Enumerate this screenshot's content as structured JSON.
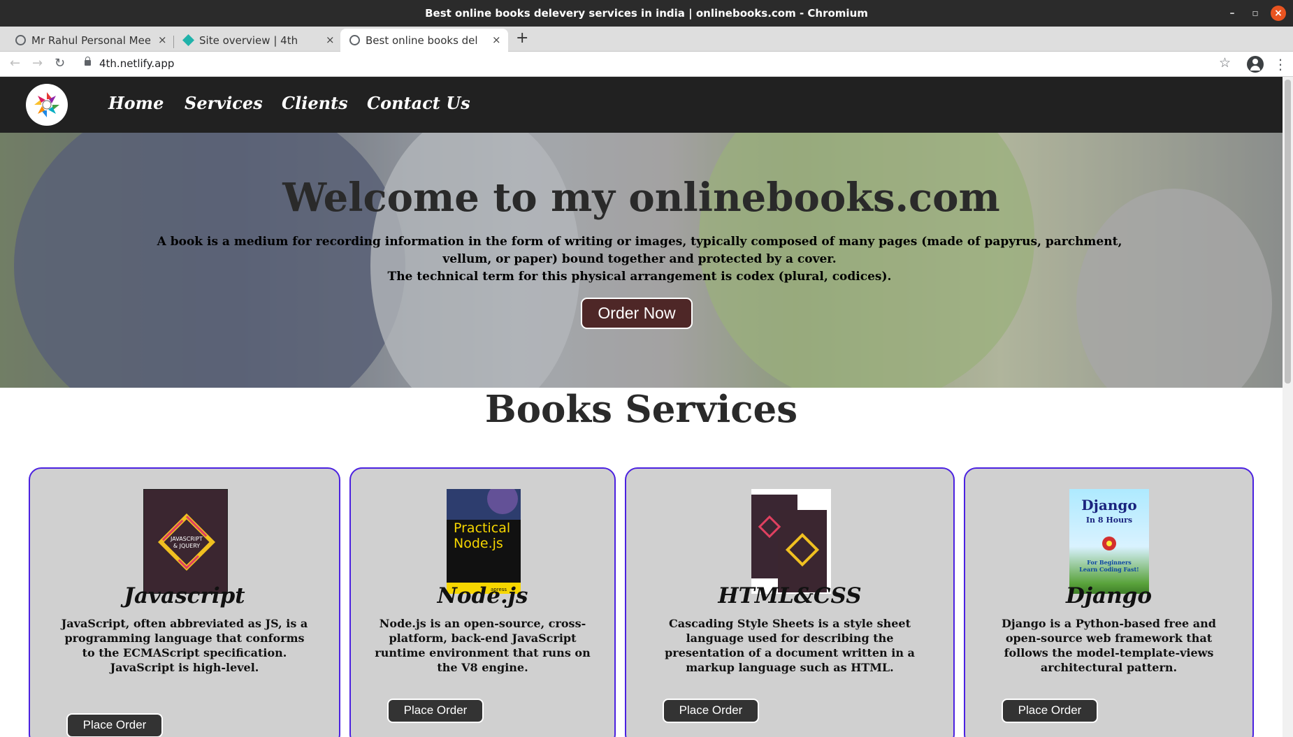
{
  "browser": {
    "window_title": "Best online books delevery services in india | onlinebooks.com - Chromium",
    "tabs": [
      {
        "label": "Mr Rahul Personal Meet",
        "icon": "globe-icon"
      },
      {
        "label": "Site overview | 4th",
        "icon": "netlify-icon"
      },
      {
        "label": "Best online books delevery services in india | onlinebooks.com",
        "icon": "globe-icon",
        "active": true
      }
    ],
    "url": "4th.netlify.app"
  },
  "site": {
    "nav": [
      "Home",
      "Services",
      "Clients",
      "Contact Us"
    ],
    "hero": {
      "title": "Welcome to my onlinebooks.com",
      "text_line1": "A book is a medium for recording information in the form of writing or images, typically composed of many pages (made of papyrus, parchment, vellum, or paper) bound together and protected by a cover.",
      "text_line2": "The technical term for this physical arrangement is codex (plural, codices).",
      "button": "Order Now"
    },
    "services_title": "Books Services",
    "cards": [
      {
        "title": "Javascript",
        "description": "JavaScript, often abbreviated as JS, is a programming language that conforms to the ECMAScript specification. JavaScript is high-level.",
        "button": "Place Order"
      },
      {
        "title": "Node.js",
        "description": "Node.js is an open-source, cross-platform, back-end JavaScript runtime environment that runs on the V8 engine.",
        "button": "Place Order"
      },
      {
        "title": "HTML&CSS",
        "description": "Cascading Style Sheets is a style sheet language used for describing the presentation of a document written in a markup language such as HTML.",
        "button": "Place Order"
      },
      {
        "title": "Django",
        "description": "Django is a Python-based free and open-source web framework that follows the model-template-views architectural pattern.",
        "button": "Place Order"
      }
    ],
    "book_covers": {
      "js": {
        "line1": "JAVASCRIPT",
        "line2": "& JQUERY"
      },
      "node": {
        "line1": "Practical",
        "line2": "Node.js",
        "publisher": "apress"
      },
      "django": {
        "line1": "Django",
        "line2": "In 8 Hours",
        "line3": "For Beginners",
        "line4": "Learn Coding Fast!"
      }
    }
  }
}
